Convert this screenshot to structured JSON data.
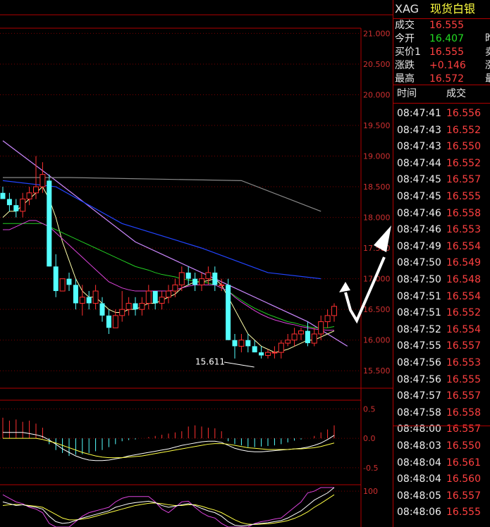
{
  "header": {
    "symbol": "XAG",
    "name": "现货白银"
  },
  "quote": {
    "rows": [
      {
        "label": "成交",
        "value": "16.555",
        "color": "#ff4040"
      },
      {
        "label": "今开",
        "value": "16.407",
        "color": "#22dd22"
      },
      {
        "label": "买价1",
        "value": "16.555",
        "color": "#ff4040"
      },
      {
        "label": "涨跌",
        "value": "+0.146",
        "color": "#ff4040"
      },
      {
        "label": "最高",
        "value": "16.572",
        "color": "#ff4040"
      }
    ],
    "clipped_right": [
      "昨",
      "卖",
      "涨",
      "最"
    ]
  },
  "ticks": {
    "time_header": "时间",
    "price_header": "成交",
    "rows": [
      {
        "time": "08:47:41",
        "price": "16.556"
      },
      {
        "time": "08:47:43",
        "price": "16.552"
      },
      {
        "time": "08:47:43",
        "price": "16.550"
      },
      {
        "time": "08:47:44",
        "price": "16.552"
      },
      {
        "time": "08:47:45",
        "price": "16.557"
      },
      {
        "time": "08:47:45",
        "price": "16.555"
      },
      {
        "time": "08:47:46",
        "price": "16.558"
      },
      {
        "time": "08:47:46",
        "price": "16.553"
      },
      {
        "time": "08:47:49",
        "price": "16.554"
      },
      {
        "time": "08:47:50",
        "price": "16.549"
      },
      {
        "time": "08:47:50",
        "price": "16.548"
      },
      {
        "time": "08:47:51",
        "price": "16.554"
      },
      {
        "time": "08:47:51",
        "price": "16.552"
      },
      {
        "time": "08:47:52",
        "price": "16.554"
      },
      {
        "time": "08:47:55",
        "price": "16.557"
      },
      {
        "time": "08:47:56",
        "price": "16.553"
      },
      {
        "time": "08:47:56",
        "price": "16.555"
      },
      {
        "time": "08:47:57",
        "price": "16.557"
      },
      {
        "time": "08:47:58",
        "price": "16.558"
      },
      {
        "time": "08:48:00",
        "price": "16.557"
      },
      {
        "time": "08:48:03",
        "price": "16.550"
      },
      {
        "time": "08:48:04",
        "price": "16.561"
      },
      {
        "time": "08:48:04",
        "price": "16.560"
      },
      {
        "time": "08:48:05",
        "price": "16.557"
      },
      {
        "time": "08:48:06",
        "price": "16.555"
      }
    ]
  },
  "chart_data": {
    "type": "candlestick",
    "y_ticks": [
      "21.000",
      "20.500",
      "20.000",
      "19.500",
      "19.000",
      "18.500",
      "18.000",
      "17.500",
      "17.000",
      "16.500",
      "16.000",
      "15.500"
    ],
    "ylim": [
      15.25,
      21.2
    ],
    "low_annotation": "15.611",
    "candles": [
      [
        18.4,
        18.5,
        18.3,
        18.3
      ],
      [
        18.3,
        18.4,
        18.1,
        18.2
      ],
      [
        18.2,
        18.3,
        18.0,
        18.1
      ],
      [
        18.1,
        18.4,
        18.0,
        18.3
      ],
      [
        18.3,
        18.5,
        18.2,
        18.4
      ],
      [
        18.4,
        19.0,
        18.3,
        18.5
      ],
      [
        18.5,
        18.9,
        18.4,
        18.7
      ],
      [
        18.6,
        18.7,
        17.2,
        17.2
      ],
      [
        17.2,
        17.4,
        16.7,
        16.8
      ],
      [
        16.8,
        17.0,
        16.9,
        17.0
      ],
      [
        17.0,
        17.1,
        16.8,
        16.9
      ],
      [
        16.9,
        17.0,
        16.5,
        16.6
      ],
      [
        16.6,
        16.9,
        16.4,
        16.7
      ],
      [
        16.7,
        16.8,
        16.5,
        16.6
      ],
      [
        16.6,
        16.9,
        16.5,
        16.8
      ],
      [
        16.6,
        16.7,
        16.3,
        16.4
      ],
      [
        16.4,
        16.5,
        16.1,
        16.2
      ],
      [
        16.2,
        16.5,
        16.2,
        16.4
      ],
      [
        16.4,
        16.8,
        16.3,
        16.5
      ],
      [
        16.5,
        16.7,
        16.4,
        16.6
      ],
      [
        16.6,
        16.7,
        16.4,
        16.5
      ],
      [
        16.5,
        16.7,
        16.4,
        16.6
      ],
      [
        16.6,
        16.9,
        16.5,
        16.8
      ],
      [
        16.8,
        16.8,
        16.5,
        16.6
      ],
      [
        16.6,
        16.8,
        16.5,
        16.7
      ],
      [
        16.7,
        16.9,
        16.6,
        16.8
      ],
      [
        16.8,
        17.0,
        16.7,
        16.9
      ],
      [
        16.9,
        17.2,
        16.8,
        17.1
      ],
      [
        17.1,
        17.2,
        16.9,
        17.0
      ],
      [
        17.0,
        17.1,
        16.8,
        16.9
      ],
      [
        16.9,
        17.1,
        16.8,
        17.0
      ],
      [
        17.0,
        17.2,
        16.9,
        17.1
      ],
      [
        17.1,
        17.2,
        16.8,
        16.9
      ],
      [
        16.9,
        17.0,
        16.8,
        16.9
      ],
      [
        16.9,
        17.0,
        16.0,
        16.0
      ],
      [
        16.0,
        16.1,
        15.7,
        15.9
      ],
      [
        15.9,
        16.1,
        15.8,
        16.0
      ],
      [
        16.0,
        16.1,
        15.8,
        15.9
      ],
      [
        15.9,
        16.0,
        15.8,
        15.8
      ],
      [
        15.8,
        15.9,
        15.7,
        15.75
      ],
      [
        15.75,
        15.85,
        15.7,
        15.8
      ],
      [
        15.8,
        15.9,
        15.7,
        15.8
      ],
      [
        15.8,
        16.0,
        15.7,
        15.95
      ],
      [
        15.95,
        16.1,
        15.9,
        16.0
      ],
      [
        16.0,
        16.2,
        15.9,
        16.1
      ],
      [
        16.1,
        16.2,
        16.0,
        16.15
      ],
      [
        16.15,
        16.3,
        15.9,
        15.95
      ],
      [
        15.95,
        16.2,
        15.9,
        16.1
      ],
      [
        16.1,
        16.4,
        16.0,
        16.3
      ],
      [
        16.3,
        16.5,
        16.2,
        16.4
      ],
      [
        16.4,
        16.6,
        16.3,
        16.55
      ]
    ],
    "ma_lines": [
      {
        "color": "#ffffaa",
        "values": [
          18.0,
          18.1,
          18.1,
          18.2,
          18.3,
          18.4,
          18.5,
          18.3,
          18.0,
          17.6,
          17.3,
          17.0,
          16.8,
          16.7,
          16.7,
          16.6,
          16.5,
          16.45,
          16.45,
          16.5,
          16.5,
          16.55,
          16.6,
          16.6,
          16.65,
          16.7,
          16.75,
          16.85,
          16.9,
          16.95,
          16.95,
          16.97,
          17.0,
          16.9,
          16.7,
          16.5,
          16.3,
          16.1,
          16.0,
          15.9,
          15.85,
          15.8,
          15.82,
          15.85,
          15.9,
          15.95,
          16.0,
          16.0,
          16.05,
          16.1,
          16.15
        ]
      },
      {
        "color": "#22cc22",
        "values": [
          17.9,
          17.9,
          17.9,
          17.9,
          17.9,
          17.9,
          17.9,
          17.85,
          17.8,
          17.75,
          17.7,
          17.65,
          17.6,
          17.55,
          17.5,
          17.45,
          17.4,
          17.35,
          17.3,
          17.25,
          17.2,
          17.17,
          17.14,
          17.1,
          17.07,
          17.05,
          17.03,
          17.0,
          16.98,
          16.96,
          16.95,
          16.93,
          16.9,
          16.85,
          16.8,
          16.72,
          16.65,
          16.58,
          16.52,
          16.47,
          16.42,
          16.38,
          16.34,
          16.3,
          16.28,
          16.25,
          16.22,
          16.2,
          16.2,
          16.2,
          16.22
        ]
      },
      {
        "color": "#dd44dd",
        "values": [
          17.8,
          17.8,
          17.85,
          17.9,
          17.95,
          17.95,
          17.9,
          17.85,
          17.75,
          17.65,
          17.55,
          17.45,
          17.35,
          17.25,
          17.15,
          17.05,
          16.95,
          16.9,
          16.85,
          16.82,
          16.8,
          16.8,
          16.8,
          16.8,
          16.8,
          16.8,
          16.82,
          16.85,
          16.88,
          16.9,
          16.9,
          16.9,
          16.9,
          16.85,
          16.8,
          16.7,
          16.62,
          16.55,
          16.48,
          16.42,
          16.37,
          16.33,
          16.3,
          16.27,
          16.25,
          16.22,
          16.2,
          16.18,
          16.17,
          16.16,
          16.16
        ]
      }
    ],
    "long_lines": [
      {
        "color": "#cc88ff",
        "points": [
          [
            0,
            19.25
          ],
          [
            8,
            18.6
          ],
          [
            20,
            17.6
          ],
          [
            34,
            16.9
          ],
          [
            46,
            16.3
          ],
          [
            52,
            15.9
          ]
        ]
      },
      {
        "color": "#2244ff",
        "points": [
          [
            0,
            18.6
          ],
          [
            8,
            18.5
          ],
          [
            18,
            17.9
          ],
          [
            30,
            17.5
          ],
          [
            40,
            17.1
          ],
          [
            48,
            17.0
          ]
        ]
      },
      {
        "color": "#888888",
        "points": [
          [
            0,
            18.65
          ],
          [
            10,
            18.65
          ],
          [
            36,
            18.6
          ],
          [
            48,
            18.1
          ]
        ]
      }
    ],
    "macd": {
      "ylim": [
        -0.55,
        0.6
      ],
      "y_ticks": [
        "0.5",
        "0.0",
        "-0.5"
      ],
      "hist": [
        0.35,
        0.3,
        0.32,
        0.28,
        0.3,
        0.25,
        0.18,
        -0.1,
        -0.2,
        -0.25,
        -0.3,
        -0.28,
        -0.27,
        -0.25,
        -0.22,
        -0.2,
        -0.15,
        -0.1,
        -0.05,
        -0.03,
        -0.02,
        0.0,
        0.02,
        0.04,
        0.06,
        0.08,
        0.1,
        0.12,
        0.2,
        0.22,
        0.2,
        0.18,
        0.17,
        0.12,
        -0.05,
        -0.1,
        -0.12,
        -0.15,
        -0.15,
        -0.14,
        -0.13,
        -0.12,
        -0.1,
        -0.07,
        -0.04,
        -0.02,
        0.0,
        0.04,
        0.1,
        0.15,
        0.22
      ],
      "dif": [
        0.1,
        0.1,
        0.1,
        0.1,
        0.08,
        0.06,
        0.03,
        -0.03,
        -0.1,
        -0.18,
        -0.24,
        -0.3,
        -0.34,
        -0.37,
        -0.38,
        -0.38,
        -0.37,
        -0.35,
        -0.33,
        -0.3,
        -0.28,
        -0.26,
        -0.24,
        -0.22,
        -0.2,
        -0.18,
        -0.15,
        -0.12,
        -0.1,
        -0.08,
        -0.06,
        -0.05,
        -0.05,
        -0.07,
        -0.12,
        -0.17,
        -0.2,
        -0.22,
        -0.23,
        -0.23,
        -0.22,
        -0.21,
        -0.2,
        -0.19,
        -0.18,
        -0.17,
        -0.15,
        -0.12,
        -0.08,
        -0.02,
        0.05
      ],
      "dea": [
        0.0,
        0.0,
        0.0,
        0.0,
        0.0,
        0.0,
        -0.02,
        -0.05,
        -0.08,
        -0.12,
        -0.16,
        -0.2,
        -0.24,
        -0.27,
        -0.3,
        -0.32,
        -0.33,
        -0.33,
        -0.33,
        -0.32,
        -0.31,
        -0.3,
        -0.28,
        -0.26,
        -0.24,
        -0.22,
        -0.2,
        -0.18,
        -0.16,
        -0.14,
        -0.12,
        -0.1,
        -0.09,
        -0.09,
        -0.1,
        -0.12,
        -0.14,
        -0.16,
        -0.17,
        -0.18,
        -0.19,
        -0.19,
        -0.19,
        -0.19,
        -0.18,
        -0.18,
        -0.17,
        -0.16,
        -0.14,
        -0.11,
        -0.08
      ]
    },
    "kdj": {
      "ylim": [
        0,
        110
      ],
      "y_ticks": [
        "100"
      ],
      "k": [
        70,
        65,
        60,
        62,
        58,
        55,
        50,
        30,
        15,
        10,
        12,
        18,
        25,
        30,
        35,
        40,
        45,
        55,
        60,
        65,
        68,
        70,
        72,
        68,
        60,
        55,
        58,
        62,
        65,
        60,
        52,
        45,
        40,
        30,
        15,
        5,
        3,
        5,
        8,
        10,
        12,
        15,
        18,
        25,
        35,
        45,
        60,
        75,
        85,
        95,
        110
      ],
      "d": [
        60,
        62,
        63,
        62,
        60,
        58,
        55,
        45,
        35,
        25,
        20,
        20,
        22,
        25,
        30,
        35,
        40,
        45,
        50,
        55,
        60,
        63,
        66,
        67,
        65,
        62,
        60,
        60,
        62,
        62,
        58,
        52,
        47,
        40,
        30,
        20,
        12,
        8,
        7,
        8,
        9,
        11,
        14,
        18,
        24,
        32,
        42,
        55,
        66,
        78,
        90
      ],
      "j": [
        90,
        80,
        70,
        65,
        55,
        50,
        40,
        10,
        0,
        0,
        0,
        15,
        30,
        40,
        45,
        50,
        55,
        70,
        80,
        85,
        85,
        85,
        85,
        70,
        50,
        40,
        55,
        70,
        72,
        55,
        40,
        30,
        25,
        10,
        0,
        0,
        0,
        0,
        10,
        15,
        18,
        22,
        25,
        40,
        55,
        70,
        95,
        100,
        110,
        110,
        110
      ]
    }
  }
}
